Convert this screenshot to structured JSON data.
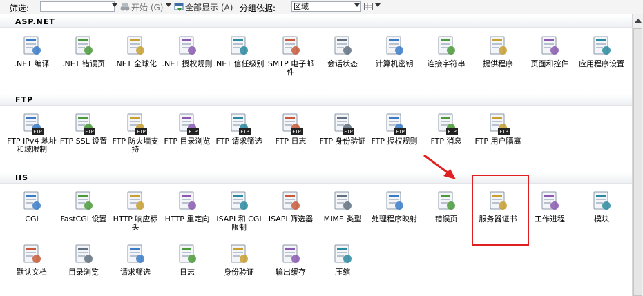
{
  "toolbar": {
    "filter_label": "筛选:",
    "filter_value": "",
    "start_label": "开始 (G)",
    "show_all_label": "全部显示 (A)",
    "group_by_label": "分组依据:",
    "group_by_value": "区域"
  },
  "sections": {
    "aspnet": "ASP.NET",
    "ftp": "FTP",
    "iis": "IIS"
  },
  "aspnet_items": [
    {
      "label": ".NET 编译",
      "icon": "net-compile-icon"
    },
    {
      "label": ".NET 错误页",
      "icon": "net-error-page-icon"
    },
    {
      "label": ".NET 全球化",
      "icon": "net-globalization-icon"
    },
    {
      "label": ".NET 授权规则",
      "icon": "net-authorization-icon"
    },
    {
      "label": ".NET 信任级别",
      "icon": "net-trust-level-icon"
    },
    {
      "label": "SMTP 电子邮件",
      "icon": "smtp-email-icon"
    },
    {
      "label": "会话状态",
      "icon": "session-state-icon"
    },
    {
      "label": "计算机密钥",
      "icon": "machine-key-icon"
    },
    {
      "label": "连接字符串",
      "icon": "connection-strings-icon"
    },
    {
      "label": "提供程序",
      "icon": "providers-icon"
    },
    {
      "label": "页面和控件",
      "icon": "pages-controls-icon"
    },
    {
      "label": "应用程序设置",
      "icon": "app-settings-icon"
    }
  ],
  "ftp_items": [
    {
      "label": "FTP IPv4 地址和域限制",
      "icon": "ftp-ip-restrictions-icon"
    },
    {
      "label": "FTP SSL 设置",
      "icon": "ftp-ssl-icon"
    },
    {
      "label": "FTP 防火墙支持",
      "icon": "ftp-firewall-icon"
    },
    {
      "label": "FTP 目录浏览",
      "icon": "ftp-directory-browsing-icon"
    },
    {
      "label": "FTP 请求筛选",
      "icon": "ftp-request-filtering-icon"
    },
    {
      "label": "FTP 日志",
      "icon": "ftp-logging-icon"
    },
    {
      "label": "FTP 身份验证",
      "icon": "ftp-authentication-icon"
    },
    {
      "label": "FTP 授权规则",
      "icon": "ftp-authorization-icon"
    },
    {
      "label": "FTP 消息",
      "icon": "ftp-messages-icon"
    },
    {
      "label": "FTP 用户隔离",
      "icon": "ftp-user-isolation-icon"
    }
  ],
  "iis_items": [
    {
      "label": "CGI",
      "icon": "cgi-icon"
    },
    {
      "label": "FastCGI 设置",
      "icon": "fastcgi-icon"
    },
    {
      "label": "HTTP 响应标头",
      "icon": "http-headers-icon"
    },
    {
      "label": "HTTP 重定向",
      "icon": "http-redirect-icon"
    },
    {
      "label": "ISAPI 和 CGI 限制",
      "icon": "isapi-cgi-restrictions-icon"
    },
    {
      "label": "ISAPI 筛选器",
      "icon": "isapi-filters-icon"
    },
    {
      "label": "MIME 类型",
      "icon": "mime-types-icon"
    },
    {
      "label": "处理程序映射",
      "icon": "handler-mappings-icon"
    },
    {
      "label": "错误页",
      "icon": "error-pages-icon"
    },
    {
      "label": "服务器证书",
      "icon": "server-certificates-icon"
    },
    {
      "label": "工作进程",
      "icon": "worker-processes-icon"
    },
    {
      "label": "模块",
      "icon": "modules-icon"
    },
    {
      "label": "默认文档",
      "icon": "default-document-icon"
    },
    {
      "label": "目录浏览",
      "icon": "directory-browsing-icon"
    },
    {
      "label": "请求筛选",
      "icon": "request-filtering-icon"
    },
    {
      "label": "日志",
      "icon": "logging-icon"
    },
    {
      "label": "身份验证",
      "icon": "authentication-icon"
    },
    {
      "label": "输出缓存",
      "icon": "output-caching-icon"
    },
    {
      "label": "压缩",
      "icon": "compression-icon"
    }
  ],
  "colors": {
    "highlight": "#e02020",
    "section_bg": "#eef0f3"
  }
}
